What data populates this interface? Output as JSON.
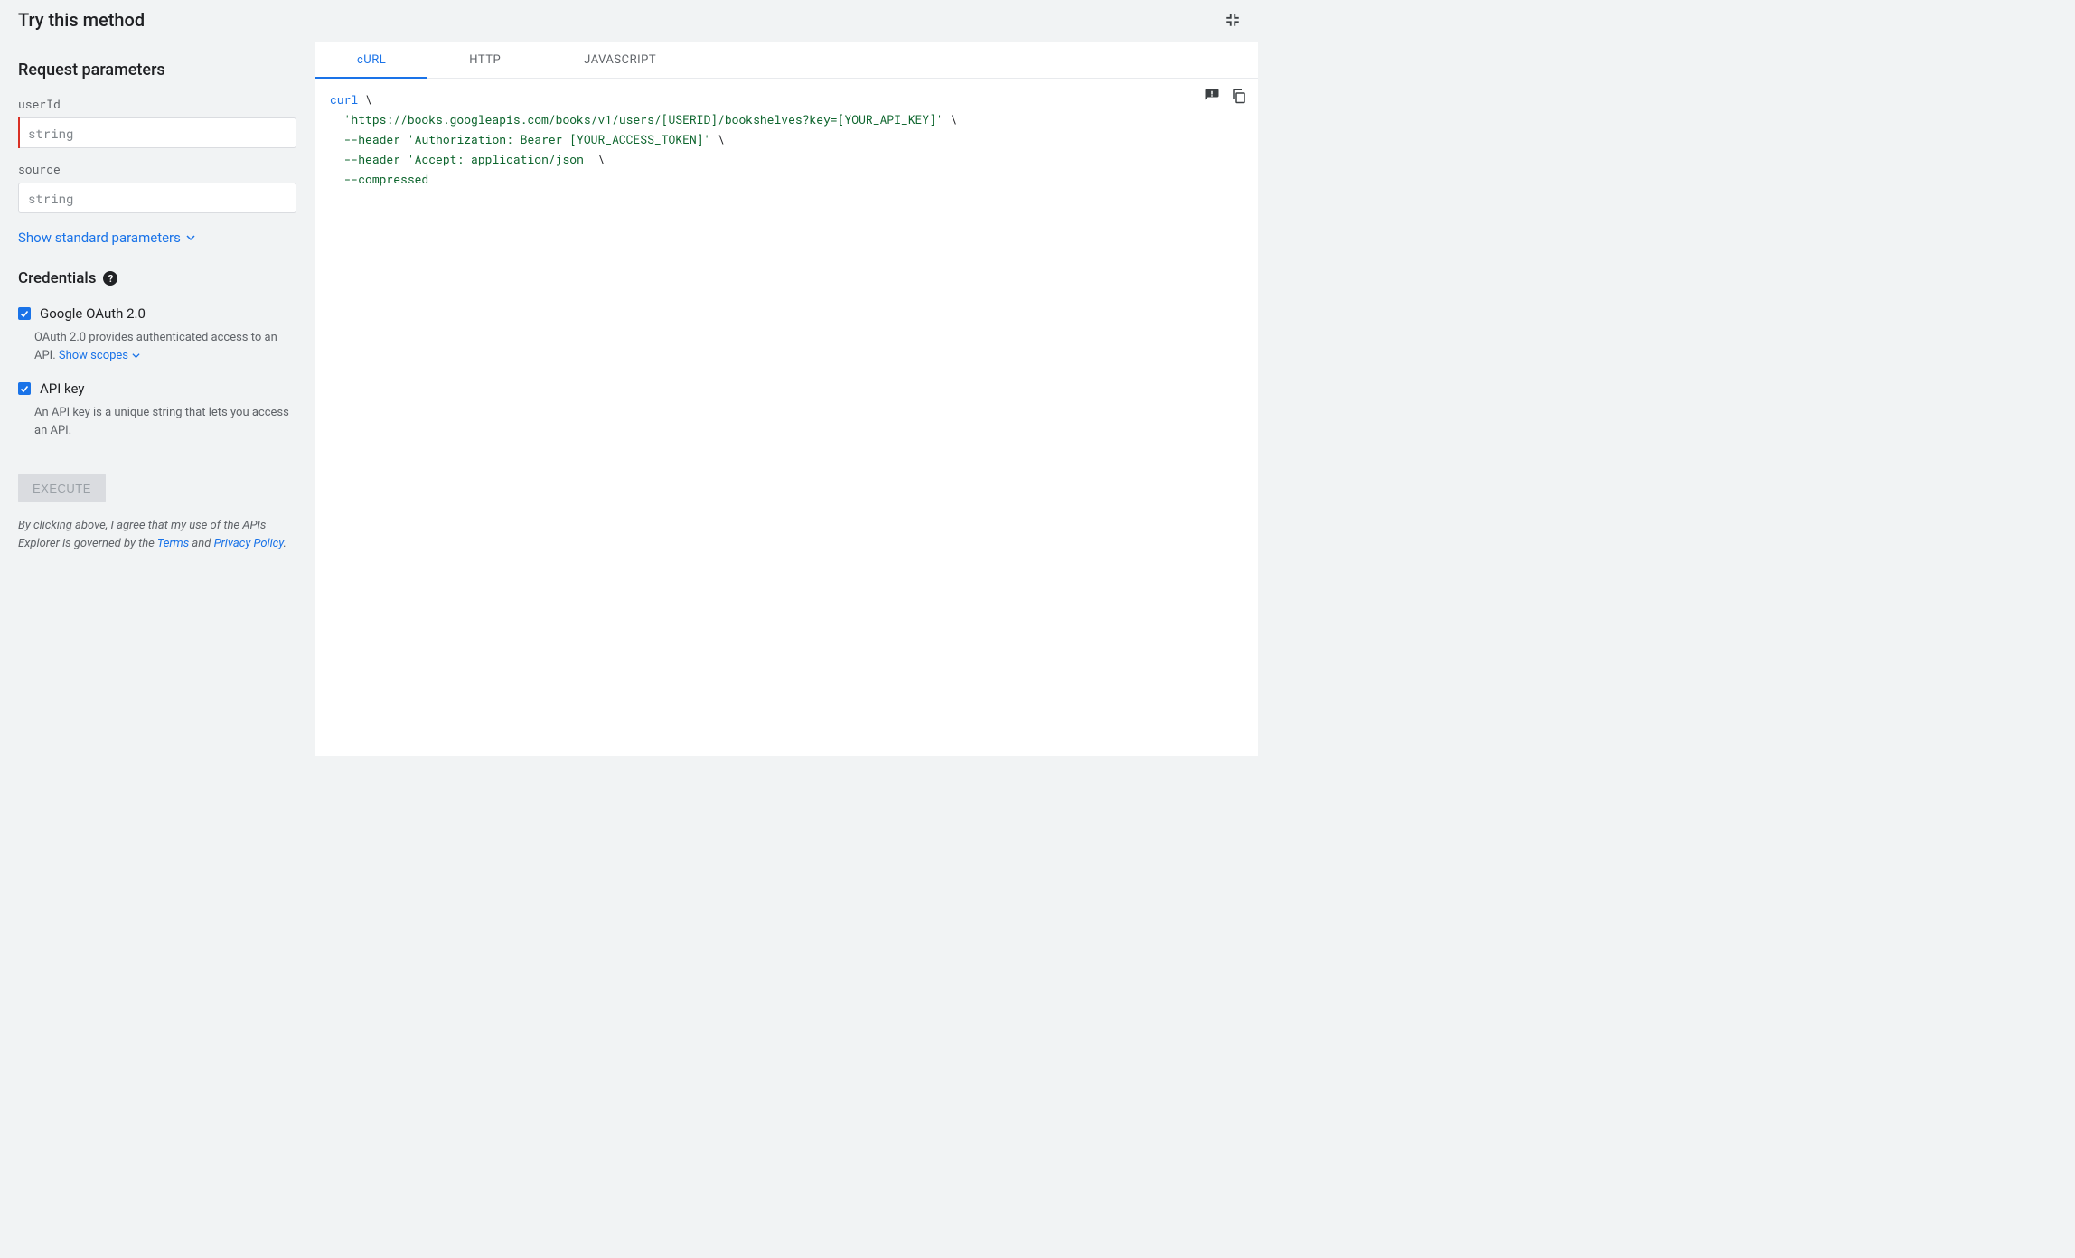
{
  "header": {
    "title": "Try this method"
  },
  "request_params": {
    "heading": "Request parameters",
    "params": [
      {
        "name": "userId",
        "placeholder": "string",
        "required": true
      },
      {
        "name": "source",
        "placeholder": "string",
        "required": false
      }
    ],
    "show_standard": "Show standard parameters"
  },
  "credentials": {
    "heading": "Credentials",
    "items": [
      {
        "label": "Google OAuth 2.0",
        "checked": true,
        "desc": "OAuth 2.0 provides authenticated access to an API.",
        "scopes_text": "Show scopes"
      },
      {
        "label": "API key",
        "checked": true,
        "desc": "An API key is a unique string that lets you access an API."
      }
    ]
  },
  "execute": {
    "label": "EXECUTE"
  },
  "disclaimer": {
    "prefix": "By clicking above, I agree that my use of the APIs Explorer is governed by the ",
    "terms": "Terms",
    "and": " and ",
    "privacy": "Privacy Policy",
    "suffix": "."
  },
  "tabs": {
    "items": [
      "cURL",
      "HTTP",
      "JAVASCRIPT"
    ],
    "active": 0
  },
  "code": {
    "cmd": "curl",
    "bs": " \\",
    "line2_pre": "  ",
    "url": "'https://books.googleapis.com/books/v1/users/[USERID]/bookshelves?key=[YOUR_API_KEY]'",
    "line3_pre": "  ",
    "flag_header1": "--header",
    "sp": " ",
    "h1": "'Authorization: Bearer [YOUR_ACCESS_TOKEN]'",
    "line4_pre": "  ",
    "flag_header2": "--header",
    "h2": "'Accept: application/json'",
    "line5_pre": "  ",
    "flag_compressed": "--compressed"
  }
}
